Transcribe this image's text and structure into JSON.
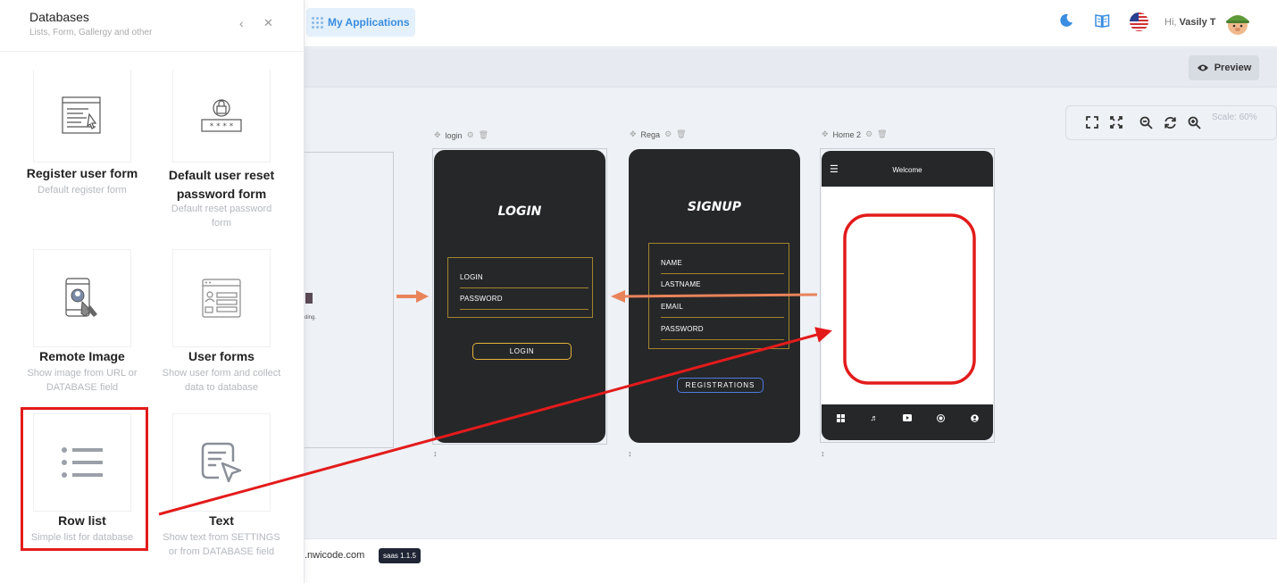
{
  "topbar": {
    "my_applications": "My Applications",
    "greeting_prefix": "Hi,",
    "user_name": "Vasily T"
  },
  "toolbar": {
    "preview_label": "Preview"
  },
  "zoom": {
    "scale_label": "Scale: 60%"
  },
  "frames": {
    "partial": {
      "fragment_text": "ding."
    },
    "login": {
      "label": "login",
      "title": "LOGIN",
      "fields": [
        "LOGIN",
        "PASSWORD"
      ],
      "button": "LOGIN"
    },
    "rega": {
      "label": "Rega",
      "title": "SIGNUP",
      "fields": [
        "NAME",
        "LASTNAME",
        "EMAIL",
        "PASSWORD"
      ],
      "button": "REGISTRATIONS"
    },
    "home": {
      "label": "Home 2",
      "header_title": "Welcome"
    }
  },
  "footer": {
    "link": ".nwicode.com",
    "version_badge": "saas 1.1.5"
  },
  "panel": {
    "title": "Databases",
    "subtitle": "Lists, Form, Gallergy and other",
    "cards": [
      {
        "title": "Register user form",
        "desc": "Default register form",
        "icon": "register-form-icon"
      },
      {
        "title": "Default user reset password form",
        "desc": "Default reset password form",
        "icon": "reset-password-icon"
      },
      {
        "title": "Remote Image",
        "desc": "Show image from URL or DATABASE field",
        "icon": "remote-image-icon"
      },
      {
        "title": "User forms",
        "desc": "Show user form and collect data to database",
        "icon": "user-forms-icon"
      },
      {
        "title": "Row list",
        "desc": "Simple list for database",
        "icon": "row-list-icon"
      },
      {
        "title": "Text",
        "desc": "Show text from SETTINGS or from DATABASE field",
        "icon": "text-icon"
      }
    ]
  },
  "colors": {
    "accent": "#3a8de0",
    "annotation_red": "#e31b1b",
    "connector_orange": "#e8835a",
    "phone_bg": "#262729",
    "field_gold": "#a1862d"
  }
}
